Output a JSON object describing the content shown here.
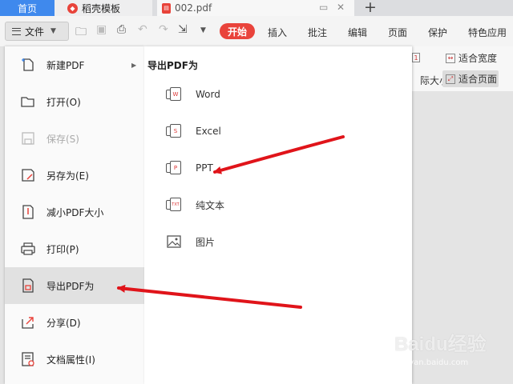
{
  "tabs": [
    {
      "label": "首页"
    },
    {
      "label": "稻壳模板"
    },
    {
      "label": "002.pdf"
    }
  ],
  "toolbar": {
    "file_label": "文件",
    "start_label": "开始",
    "menu_tabs": [
      "插入",
      "批注",
      "编辑",
      "页面",
      "保护",
      "特色应用"
    ]
  },
  "ribbon": {
    "fit_width": "适合宽度",
    "fit_page": "适合页面",
    "actual_size": "实际大小"
  },
  "file_menu": {
    "items": [
      {
        "label": "新建PDF",
        "icon": "new-pdf-icon"
      },
      {
        "label": "打开(O)",
        "icon": "folder-open-icon"
      },
      {
        "label": "保存(S)",
        "icon": "save-icon"
      },
      {
        "label": "另存为(E)",
        "icon": "save-as-icon"
      },
      {
        "label": "减小PDF大小",
        "icon": "compress-icon"
      },
      {
        "label": "打印(P)",
        "icon": "print-icon"
      },
      {
        "label": "导出PDF为",
        "icon": "export-icon"
      },
      {
        "label": "分享(D)",
        "icon": "share-icon"
      },
      {
        "label": "文档属性(I)",
        "icon": "properties-icon"
      }
    ]
  },
  "export_menu": {
    "title": "导出PDF为",
    "items": [
      {
        "label": "Word",
        "icon": "word-icon",
        "badge": "W"
      },
      {
        "label": "Excel",
        "icon": "excel-icon",
        "badge": "S"
      },
      {
        "label": "PPT",
        "icon": "ppt-icon",
        "badge": "P"
      },
      {
        "label": "纯文本",
        "icon": "text-icon",
        "badge": "TXT"
      },
      {
        "label": "图片",
        "icon": "image-icon",
        "badge": ""
      }
    ]
  },
  "watermark": {
    "text": "Baidu经验",
    "sub": "jingyan.baidu.com"
  },
  "colors": {
    "accent": "#e9433b",
    "home_tab": "#3f89ed",
    "arrow": "#e0141a"
  }
}
